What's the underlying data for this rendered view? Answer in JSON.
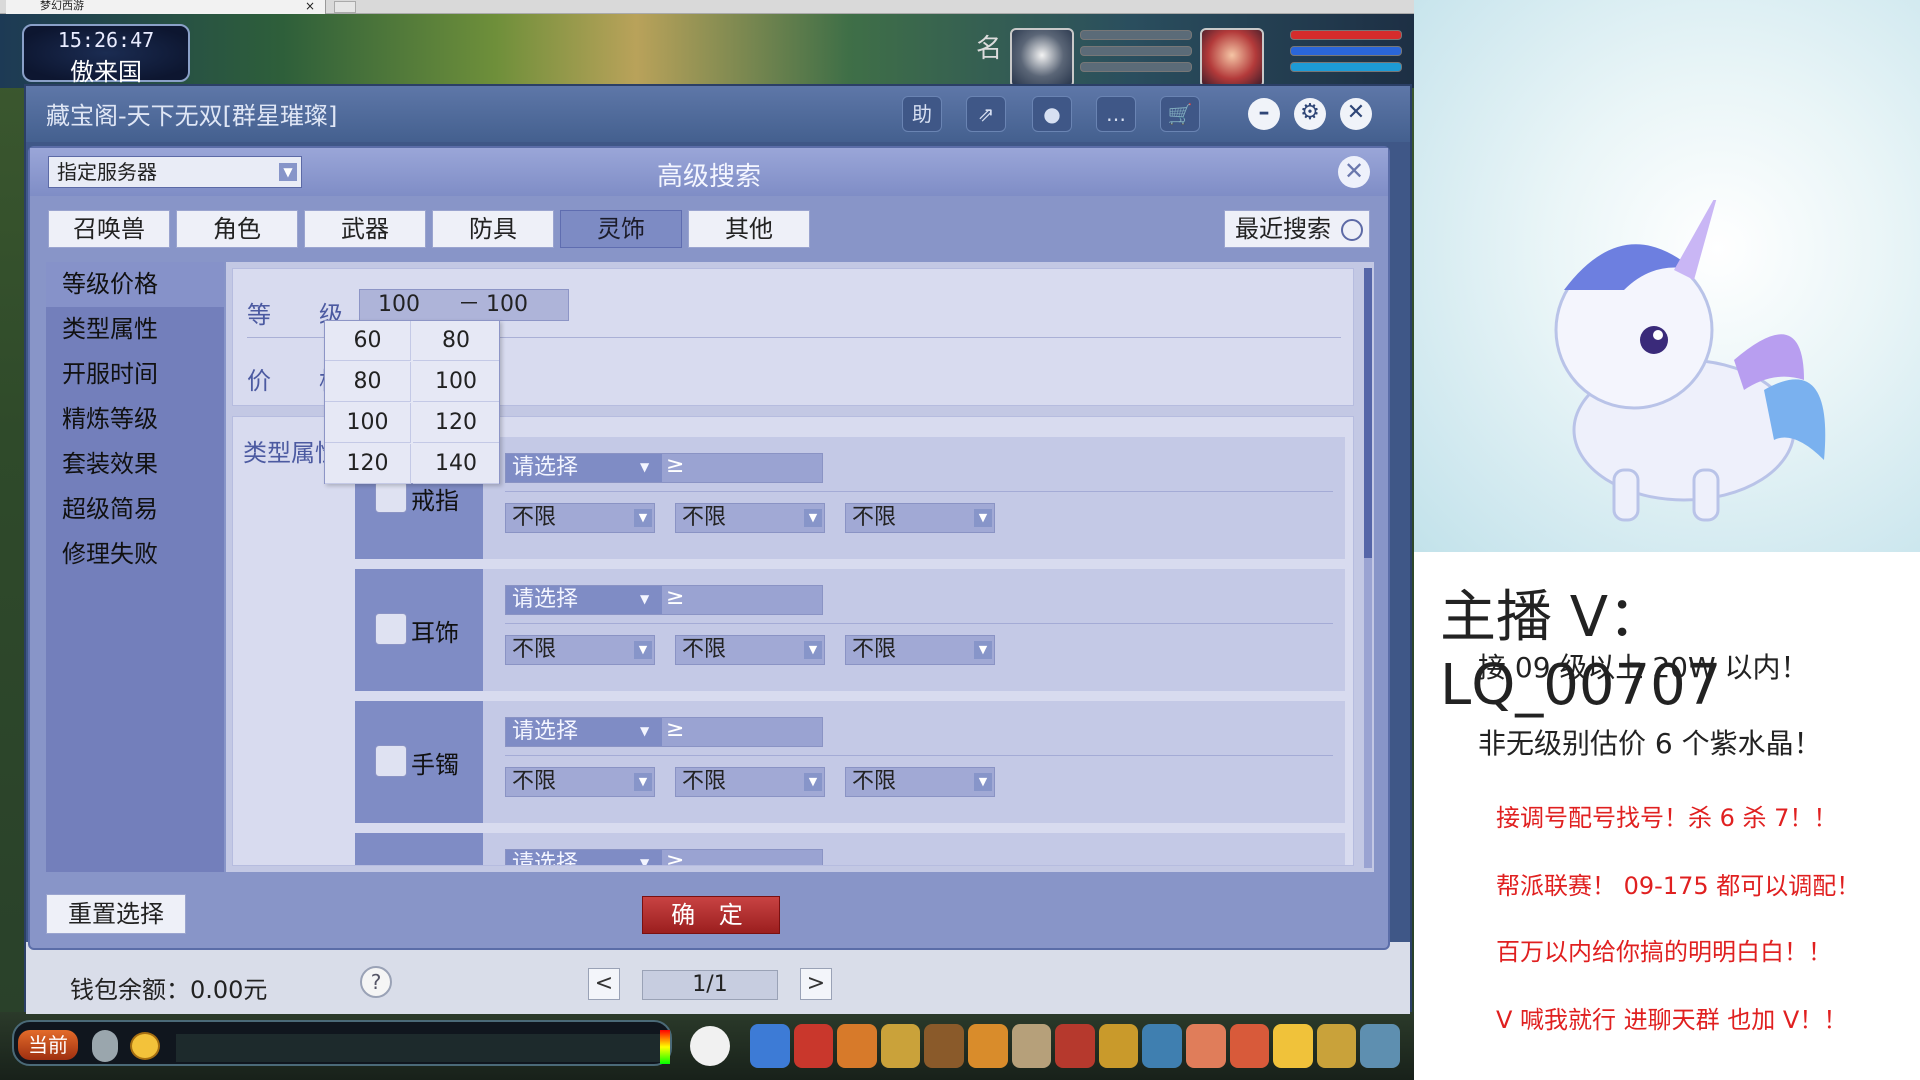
{
  "browser": {
    "tab_title": "梦幻西游",
    "tab_close": "×",
    "new_tab": "+"
  },
  "game_hud": {
    "clock": "15:26:47",
    "place": "傲来国",
    "name_hint": "名"
  },
  "zbg": {
    "title": "藏宝阁-天下无双[群星璀璨]",
    "toolbar": {
      "help": "助",
      "share": "⇗",
      "record": "●",
      "chat": "…",
      "cart": "🛒",
      "minimize": "–",
      "settings": "⚙",
      "close": "✕"
    }
  },
  "advanced_search": {
    "title": "高级搜索",
    "server_select": "指定服务器",
    "close": "✕",
    "categories": [
      "召唤兽",
      "角色",
      "武器",
      "防具",
      "灵饰",
      "其他"
    ],
    "active_category": "灵饰",
    "recent_search": "最近搜索",
    "side_menu": [
      "等级价格",
      "类型属性",
      "开服时间",
      "精炼等级",
      "套装效果",
      "超级简易",
      "修理失败"
    ],
    "level": {
      "label_a": "等",
      "label_b": "级",
      "min": "100",
      "dash": "－",
      "max": "100"
    },
    "price": {
      "label_a": "价",
      "label_b": "格"
    },
    "level_options": [
      [
        "60",
        "80"
      ],
      [
        "80",
        "100"
      ],
      [
        "100",
        "120"
      ],
      [
        "120",
        "140"
      ]
    ],
    "type_attr_label": "类型属性",
    "types": [
      {
        "name": "戒指",
        "select": "请选择",
        "filters": [
          "不限",
          "不限",
          "不限"
        ]
      },
      {
        "name": "耳饰",
        "select": "请选择",
        "filters": [
          "不限",
          "不限",
          "不限"
        ]
      },
      {
        "name": "手镯",
        "select": "请选择",
        "filters": [
          "不限",
          "不限",
          "不限"
        ]
      },
      {
        "name": "",
        "select": "请选择",
        "filters": []
      }
    ],
    "ge_symbol": "≥",
    "reset": "重置选择",
    "confirm": "确 定"
  },
  "footer": {
    "wallet": "钱包余额：0.00元",
    "help": "?",
    "prev": "<",
    "page": "1/1",
    "next": ">"
  },
  "chat": {
    "tab": "当前"
  },
  "overlay": {
    "host": "主播 V：LQ_00707",
    "line1": "接 09 级以上 20W 以内！",
    "line2": "非无级别估价 6 个紫水晶！",
    "red1": "接调号配号找号！杀 6 杀 7！！",
    "red2": "帮派联赛！ 09-175 都可以调配！",
    "red3": "百万以内给你搞的明明白白！！",
    "red4": "V 喊我就行  进聊天群 也加 V！！"
  }
}
